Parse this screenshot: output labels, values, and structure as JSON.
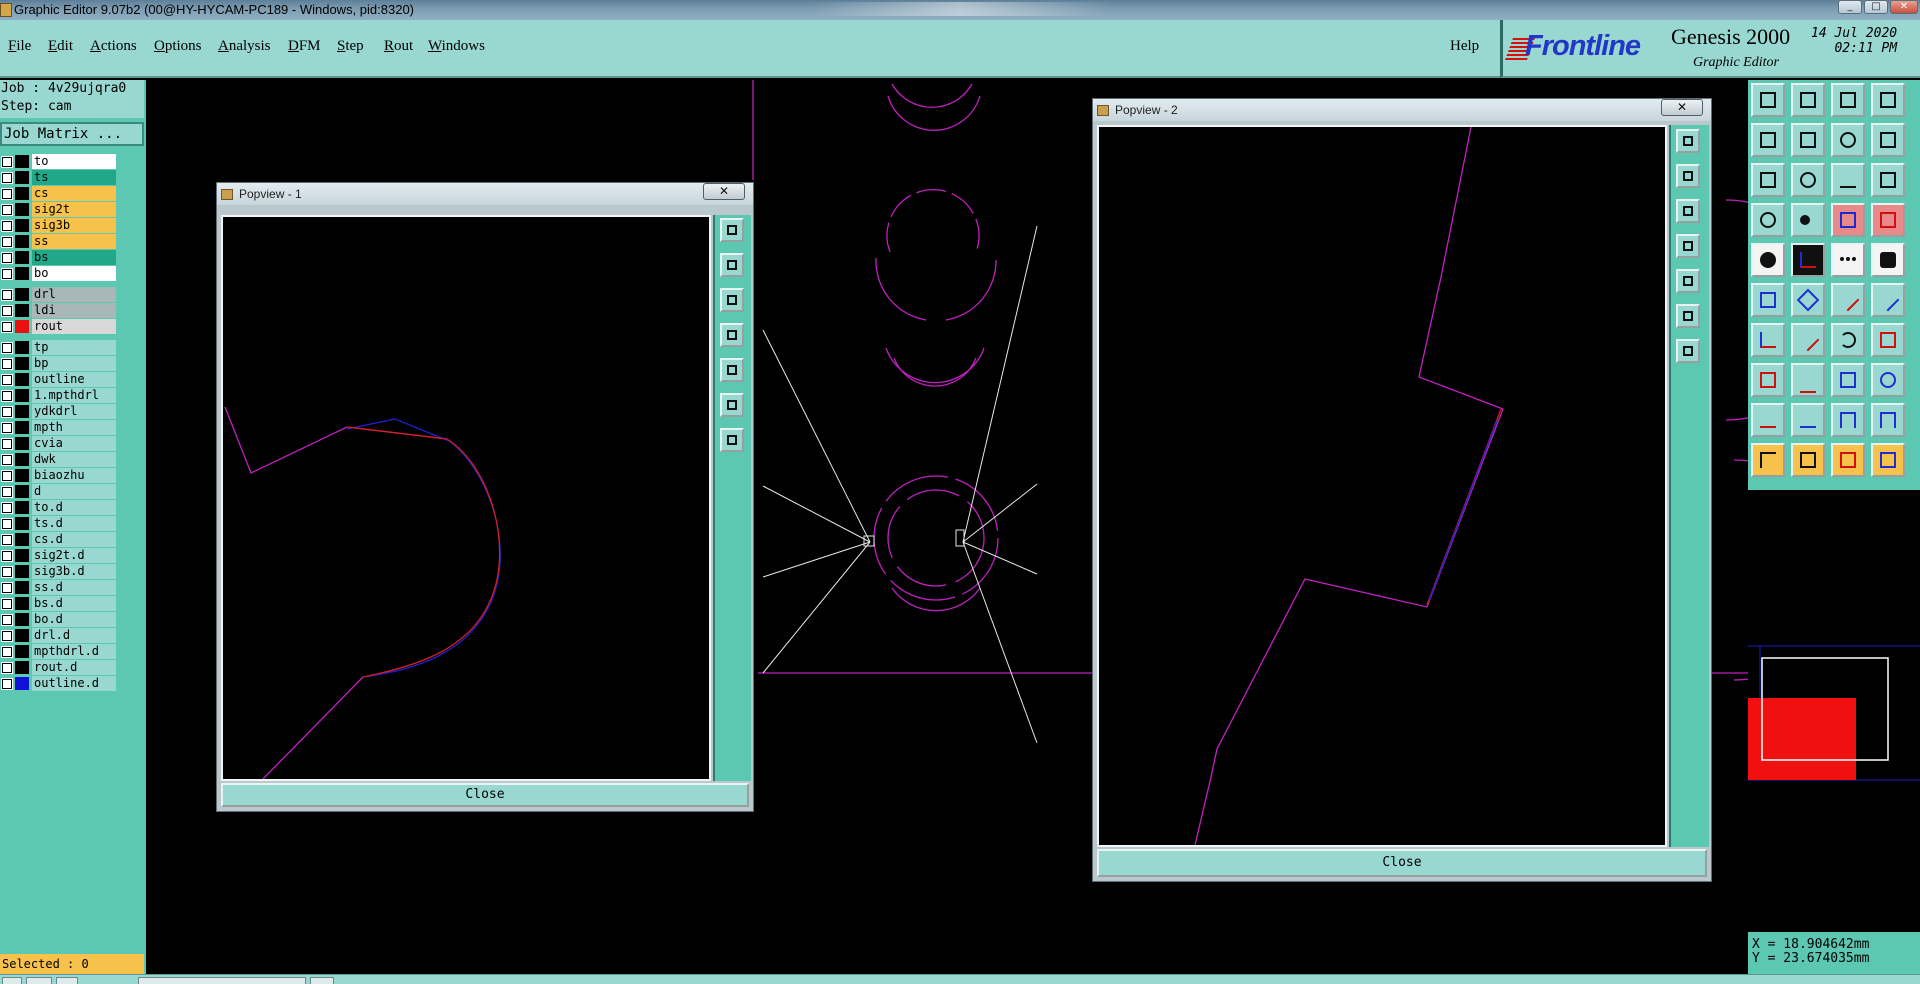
{
  "window": {
    "title": "Graphic Editor 9.07b2 (00@HY-HYCAM-PC189 - Windows, pid:8320)",
    "min_label": "_",
    "max_label": "□",
    "close_label": "✕"
  },
  "menu": {
    "items": [
      {
        "first": "F",
        "rest": "ile"
      },
      {
        "first": "E",
        "rest": "dit"
      },
      {
        "first": "A",
        "rest": "ctions"
      },
      {
        "first": "O",
        "rest": "ptions"
      },
      {
        "first": "A",
        "rest": "nalysis"
      },
      {
        "first": "D",
        "rest": "FM"
      },
      {
        "first": "S",
        "rest": "tep"
      },
      {
        "first": "R",
        "rest": "out"
      },
      {
        "first": "W",
        "rest": "indows"
      }
    ],
    "help": "Help"
  },
  "brand": {
    "logo": "Frontline",
    "product": "Genesis 2000",
    "subtitle": "Graphic Editor",
    "date": "14 Jul 2020",
    "time": "02:11 PM"
  },
  "job": {
    "job_line": "Job : 4v29ujqra0",
    "step_line": "Step: cam",
    "matrix_label": "Job Matrix ..."
  },
  "layers": [
    {
      "name": "to",
      "color": "#ffffff",
      "swatch": "#000000"
    },
    {
      "name": "ts",
      "color": "#20a888",
      "swatch": "#000000"
    },
    {
      "name": "cs",
      "color": "#f6c24c",
      "swatch": "#000000"
    },
    {
      "name": "sig2t",
      "color": "#f6c24c",
      "swatch": "#000000"
    },
    {
      "name": "sig3b",
      "color": "#f6c24c",
      "swatch": "#000000"
    },
    {
      "name": "ss",
      "color": "#f6c24c",
      "swatch": "#000000"
    },
    {
      "name": "bs",
      "color": "#20a888",
      "swatch": "#000000"
    },
    {
      "name": "bo",
      "color": "#ffffff",
      "swatch": "#000000"
    },
    {
      "name": "drl",
      "color": "#a8b8b8",
      "swatch": "#000000"
    },
    {
      "name": "ldi",
      "color": "#a8b8b8",
      "swatch": "#000000"
    },
    {
      "name": "rout",
      "color": "#d8d8d8",
      "swatch": "#e81010"
    },
    {
      "name": "tp",
      "color": "#98d8d0",
      "swatch": "#000000"
    },
    {
      "name": "bp",
      "color": "#98d8d0",
      "swatch": "#000000"
    },
    {
      "name": "outline",
      "color": "#98d8d0",
      "swatch": "#000000"
    },
    {
      "name": "1.mpthdrl",
      "color": "#98d8d0",
      "swatch": "#000000"
    },
    {
      "name": "ydkdrl",
      "color": "#98d8d0",
      "swatch": "#000000"
    },
    {
      "name": "mpth",
      "color": "#98d8d0",
      "swatch": "#000000"
    },
    {
      "name": "cvia",
      "color": "#98d8d0",
      "swatch": "#000000"
    },
    {
      "name": "dwk",
      "color": "#98d8d0",
      "swatch": "#000000"
    },
    {
      "name": "biaozhu",
      "color": "#98d8d0",
      "swatch": "#000000"
    },
    {
      "name": "d",
      "color": "#98d8d0",
      "swatch": "#000000"
    },
    {
      "name": "to.d",
      "color": "#98d8d0",
      "swatch": "#000000"
    },
    {
      "name": "ts.d",
      "color": "#98d8d0",
      "swatch": "#000000"
    },
    {
      "name": "cs.d",
      "color": "#98d8d0",
      "swatch": "#000000"
    },
    {
      "name": "sig2t.d",
      "color": "#98d8d0",
      "swatch": "#000000"
    },
    {
      "name": "sig3b.d",
      "color": "#98d8d0",
      "swatch": "#000000"
    },
    {
      "name": "ss.d",
      "color": "#98d8d0",
      "swatch": "#000000"
    },
    {
      "name": "bs.d",
      "color": "#98d8d0",
      "swatch": "#000000"
    },
    {
      "name": "bo.d",
      "color": "#98d8d0",
      "swatch": "#000000"
    },
    {
      "name": "drl.d",
      "color": "#98d8d0",
      "swatch": "#000000"
    },
    {
      "name": "mpthdrl.d",
      "color": "#98d8d0",
      "swatch": "#000000"
    },
    {
      "name": "rout.d",
      "color": "#98d8d0",
      "swatch": "#000000"
    },
    {
      "name": "outline.d",
      "color": "#98d8d0",
      "swatch": "#1010d8"
    }
  ],
  "status": {
    "selected": "Selected : 0",
    "x": "X = 18.904642mm",
    "y": "Y = 23.674035mm"
  },
  "popview1": {
    "title": "Popview - 1",
    "close_label": "Close",
    "x_label": "✕"
  },
  "popview2": {
    "title": "Popview - 2",
    "close_label": "Close",
    "x_label": "✕"
  },
  "colors": {
    "panel": "#5cc8b2",
    "menubar": "#98d8d0",
    "accent_yellow": "#f6c24c",
    "feature_magenta": "#c020c0"
  }
}
